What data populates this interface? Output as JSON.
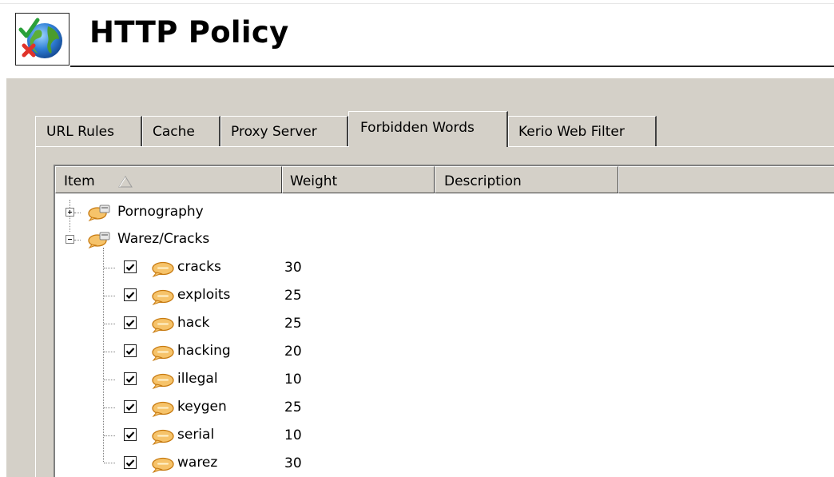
{
  "header": {
    "title": "HTTP Policy",
    "icon": "http-policy-globe-check-icon"
  },
  "tabs": [
    {
      "label": "URL Rules",
      "active": false
    },
    {
      "label": "Cache",
      "active": false
    },
    {
      "label": "Proxy Server",
      "active": false
    },
    {
      "label": "Forbidden Words",
      "active": true
    },
    {
      "label": "Kerio Web Filter",
      "active": false
    }
  ],
  "list": {
    "columns": [
      {
        "label": "Item",
        "sort": "ascending"
      },
      {
        "label": "Weight"
      },
      {
        "label": "Description"
      },
      {
        "label": ""
      }
    ],
    "groups": [
      {
        "label": "Pornography",
        "expanded": false
      },
      {
        "label": "Warez/Cracks",
        "expanded": true
      }
    ],
    "items": [
      {
        "label": "cracks",
        "weight": "30",
        "checked": true
      },
      {
        "label": "exploits",
        "weight": "25",
        "checked": true
      },
      {
        "label": "hack",
        "weight": "25",
        "checked": true
      },
      {
        "label": "hacking",
        "weight": "20",
        "checked": true
      },
      {
        "label": "illegal",
        "weight": "10",
        "checked": true
      },
      {
        "label": "keygen",
        "weight": "25",
        "checked": true
      },
      {
        "label": "serial",
        "weight": "10",
        "checked": true
      },
      {
        "label": "warez",
        "weight": "30",
        "checked": true
      }
    ]
  },
  "colors": {
    "panel_bg": "#d4d0c8",
    "bubble_fill": "#f6c36a",
    "bubble_stroke": "#c77a10"
  }
}
